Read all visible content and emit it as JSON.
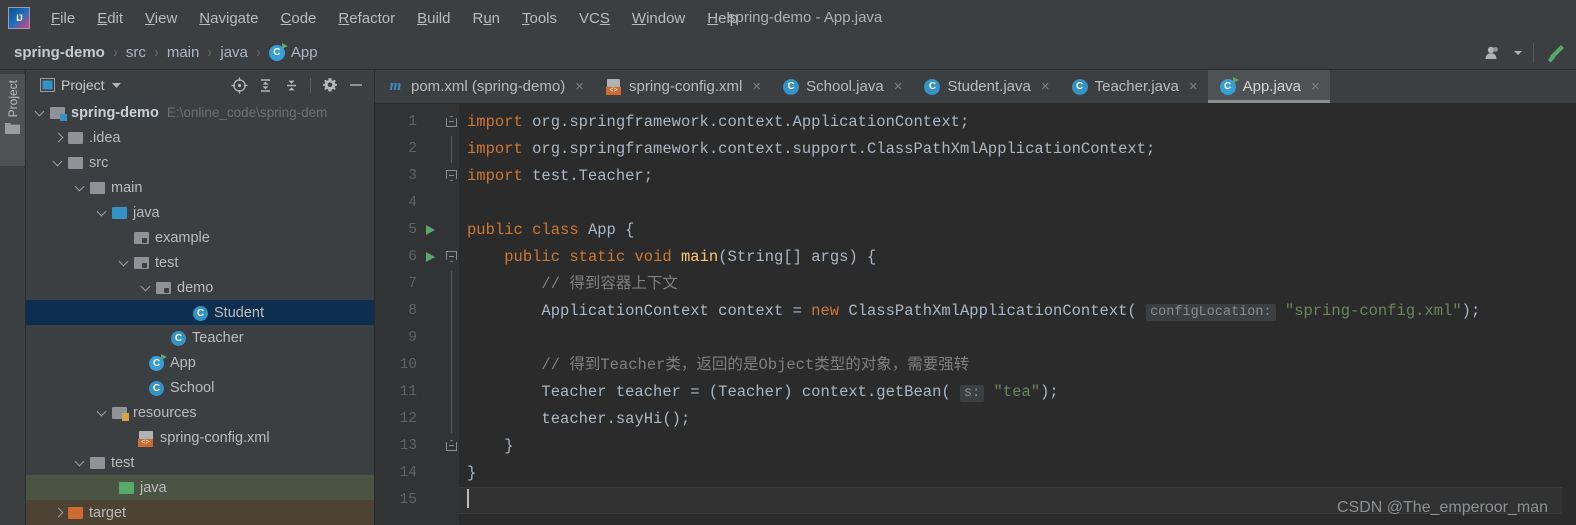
{
  "window": {
    "title": "spring-demo - App.java",
    "logo_icon": "intellij-idea-logo"
  },
  "menubar": {
    "items": [
      {
        "label": "File",
        "mnemonic": "F"
      },
      {
        "label": "Edit",
        "mnemonic": "E"
      },
      {
        "label": "View",
        "mnemonic": "V"
      },
      {
        "label": "Navigate",
        "mnemonic": "N"
      },
      {
        "label": "Code",
        "mnemonic": "C"
      },
      {
        "label": "Refactor",
        "mnemonic": "R"
      },
      {
        "label": "Build",
        "mnemonic": "B"
      },
      {
        "label": "Run",
        "mnemonic": "u"
      },
      {
        "label": "Tools",
        "mnemonic": "T"
      },
      {
        "label": "VCS",
        "mnemonic": "S"
      },
      {
        "label": "Window",
        "mnemonic": "W"
      },
      {
        "label": "Help",
        "mnemonic": "H"
      }
    ]
  },
  "navbar": {
    "crumbs": [
      {
        "label": "spring-demo",
        "icon": null
      },
      {
        "label": "src",
        "icon": null
      },
      {
        "label": "main",
        "icon": null
      },
      {
        "label": "java",
        "icon": null
      },
      {
        "label": "App",
        "icon": "java-class-runnable-icon"
      }
    ],
    "separator": "›",
    "right_icons": [
      "user-account-icon",
      "chevron-down-icon",
      "hammer-build-icon"
    ]
  },
  "toolstrip": {
    "project_tab_label": "Project",
    "project_tab_icon": "folder-icon"
  },
  "project_panel": {
    "title": "Project",
    "title_icon": "project-view-icon",
    "dropdown_icon": "chevron-down-icon",
    "toolbar_icons": [
      "locate-target-icon",
      "expand-all-icon",
      "collapse-all-icon",
      "settings-gear-icon",
      "hide-minimize-icon"
    ],
    "tree": [
      {
        "label": "spring-demo",
        "path": "E:\\online_code\\spring-dem",
        "icon": "folder-module-icon",
        "indent": 0,
        "arrow": "down",
        "bold": true,
        "state": "normal"
      },
      {
        "label": ".idea",
        "path": "",
        "icon": "folder-icon",
        "indent": 1,
        "arrow": "right",
        "bold": false,
        "state": "normal"
      },
      {
        "label": "src",
        "path": "",
        "icon": "folder-icon",
        "indent": 1,
        "arrow": "down",
        "bold": false,
        "state": "normal"
      },
      {
        "label": "main",
        "path": "",
        "icon": "folder-icon",
        "indent": 2,
        "arrow": "down",
        "bold": false,
        "state": "normal"
      },
      {
        "label": "java",
        "path": "",
        "icon": "folder-source-blue-icon",
        "indent": 3,
        "arrow": "down",
        "bold": false,
        "state": "normal"
      },
      {
        "label": "example",
        "path": "",
        "icon": "package-icon",
        "indent": 4,
        "arrow": "none",
        "bold": false,
        "state": "normal"
      },
      {
        "label": "test",
        "path": "",
        "icon": "package-icon",
        "indent": 4,
        "arrow": "down",
        "bold": false,
        "state": "normal"
      },
      {
        "label": "demo",
        "path": "",
        "icon": "package-icon",
        "indent": 5,
        "arrow": "down",
        "bold": false,
        "state": "normal"
      },
      {
        "label": "Student",
        "path": "",
        "icon": "java-class-icon",
        "indent": 6,
        "arrow": "none",
        "bold": false,
        "state": "selected"
      },
      {
        "label": "Teacher",
        "path": "",
        "icon": "java-class-icon",
        "indent": 5,
        "arrow": "none",
        "bold": false,
        "state": "normal"
      },
      {
        "label": "App",
        "path": "",
        "icon": "java-class-runnable-icon",
        "indent": 4,
        "arrow": "none",
        "bold": false,
        "state": "normal"
      },
      {
        "label": "School",
        "path": "",
        "icon": "java-class-icon",
        "indent": 4,
        "arrow": "none",
        "bold": false,
        "state": "normal"
      },
      {
        "label": "resources",
        "path": "",
        "icon": "folder-resources-icon",
        "indent": 3,
        "arrow": "down",
        "bold": false,
        "state": "normal"
      },
      {
        "label": "spring-config.xml",
        "path": "",
        "icon": "xml-file-icon",
        "indent": 4,
        "arrow": "none",
        "bold": false,
        "state": "normal"
      },
      {
        "label": "test",
        "path": "",
        "icon": "folder-icon",
        "indent": 2,
        "arrow": "down",
        "bold": false,
        "state": "normal"
      },
      {
        "label": "java",
        "path": "",
        "icon": "folder-test-source-green-icon",
        "indent": 3,
        "arrow": "none",
        "bold": false,
        "state": "test-source"
      },
      {
        "label": "target",
        "path": "",
        "icon": "folder-excluded-orange-icon",
        "indent": 1,
        "arrow": "right",
        "bold": false,
        "state": "excluded"
      }
    ]
  },
  "editor_tabs": [
    {
      "label": "pom.xml (spring-demo)",
      "icon": "maven-icon",
      "active": false,
      "close": "×"
    },
    {
      "label": "spring-config.xml",
      "icon": "xml-file-icon",
      "active": false,
      "close": "×"
    },
    {
      "label": "School.java",
      "icon": "java-class-icon",
      "active": false,
      "close": "×"
    },
    {
      "label": "Student.java",
      "icon": "java-class-icon",
      "active": false,
      "close": "×"
    },
    {
      "label": "Teacher.java",
      "icon": "java-class-icon",
      "active": false,
      "close": "×"
    },
    {
      "label": "App.java",
      "icon": "java-class-runnable-icon",
      "active": true,
      "close": "×"
    }
  ],
  "editor": {
    "line_numbers": [
      "1",
      "2",
      "3",
      "4",
      "5",
      "6",
      "7",
      "8",
      "9",
      "10",
      "11",
      "12",
      "13",
      "14",
      "15"
    ],
    "current_line": 15,
    "run_markers": [
      5,
      6
    ],
    "lines": [
      {
        "n": 1,
        "text": "import org.springframework.context.ApplicationContext;"
      },
      {
        "n": 2,
        "text": "import org.springframework.context.support.ClassPathXmlApplicationContext;"
      },
      {
        "n": 3,
        "text": "import test.Teacher;"
      },
      {
        "n": 4,
        "text": ""
      },
      {
        "n": 5,
        "text": "public class App {"
      },
      {
        "n": 6,
        "text": "    public static void main(String[] args) {"
      },
      {
        "n": 7,
        "text": "        // 得到容器上下文"
      },
      {
        "n": 8,
        "text": "        ApplicationContext context = new ClassPathXmlApplicationContext( configLocation: \"spring-config.xml\");"
      },
      {
        "n": 9,
        "text": ""
      },
      {
        "n": 10,
        "text": "        // 得到Teacher类，返回的是Object类型的对象，需要强转"
      },
      {
        "n": 11,
        "text": "        Teacher teacher = (Teacher) context.getBean( s: \"tea\");"
      },
      {
        "n": 12,
        "text": "        teacher.sayHi();"
      },
      {
        "n": 13,
        "text": "    }"
      },
      {
        "n": 14,
        "text": "}"
      },
      {
        "n": 15,
        "text": ""
      }
    ],
    "tokens": {
      "kw_import": "import",
      "kw_public": "public",
      "kw_class": "class",
      "kw_static": "static",
      "kw_void": "void",
      "kw_new": "new",
      "pkg1": " org.springframework.context.ApplicationContext;",
      "pkg2": " org.springframework.context.support.ClassPathXmlApplicationContext;",
      "pkg3": " test.Teacher;",
      "cls_app": " App {",
      "main_name": "main",
      "main_args": "(String[] args) {",
      "comment7": "// 得到容器上下文",
      "l8_a": "ApplicationContext context = ",
      "l8_b": "ClassPathXmlApplicationContext(",
      "l8_hint": "configLocation:",
      "l8_str": "\"spring-config.xml\"",
      "l8_end": ");",
      "comment10": "// 得到Teacher类，返回的是Object类型的对象，需要强转",
      "l11_a": "Teacher teacher = (Teacher) context.",
      "l11_m": "getBean",
      "l11_open": "(",
      "l11_hint": "s:",
      "l11_str": "\"tea\"",
      "l11_end": ");",
      "l12_a": "teacher.",
      "l12_m": "sayHi",
      "l12_end": "();",
      "brace_close_inner": "}",
      "brace_close_outer": "}"
    }
  },
  "watermark": "CSDN @The_emperoor_man",
  "colors": {
    "ui_background": "#3c3f41",
    "editor_background": "#2b2b2b",
    "gutter_background": "#313335",
    "selection": "#0d2f4f",
    "test_source_row": "#4a5443",
    "excluded_row": "#4c4335",
    "keyword": "#cc7832",
    "string": "#6a8759",
    "comment": "#808080",
    "method": "#ffc66d",
    "default_text": "#a9b7c6",
    "accent_blue": "#3592c4",
    "accent_green": "#59a869",
    "accent_orange": "#cf6a32"
  }
}
